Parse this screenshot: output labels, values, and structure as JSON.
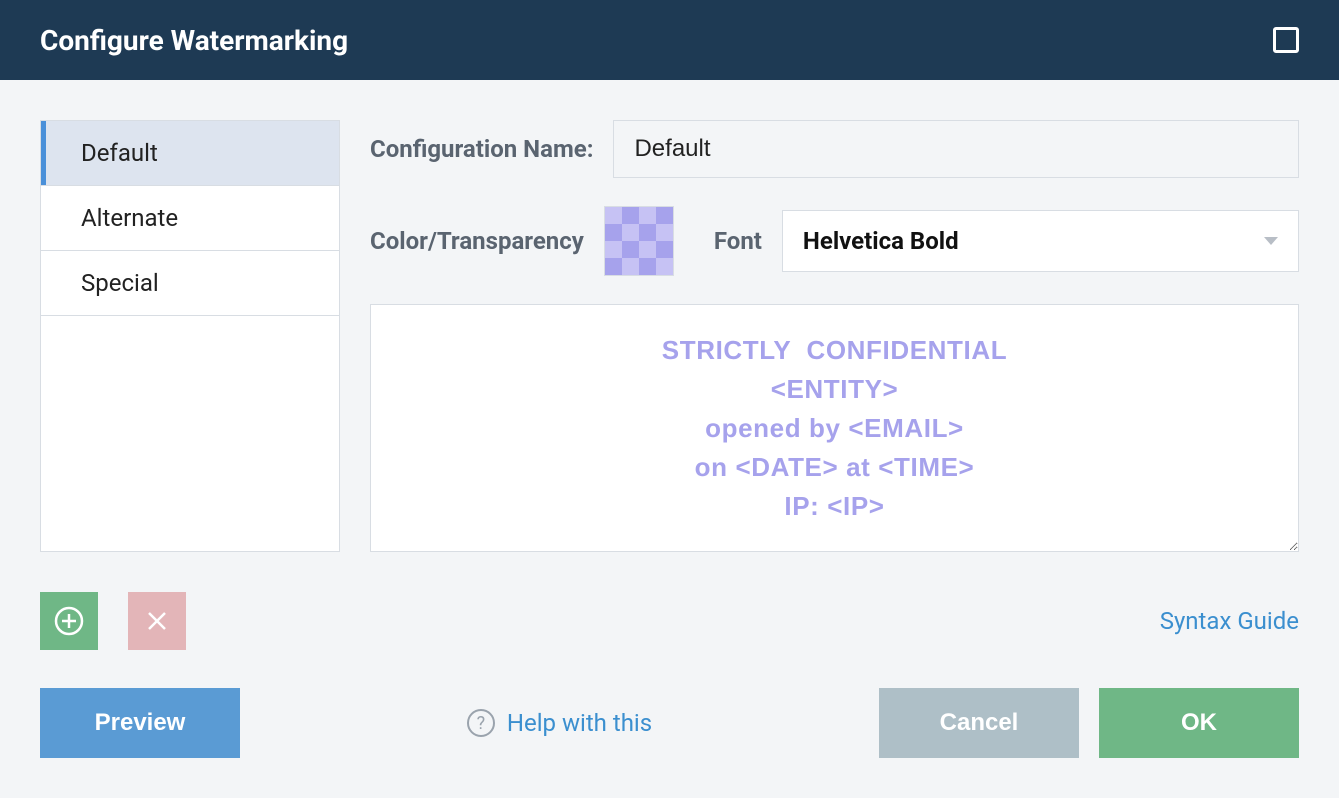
{
  "title": "Configure Watermarking",
  "sidebar": {
    "items": [
      {
        "label": "Default",
        "selected": true
      },
      {
        "label": "Alternate",
        "selected": false
      },
      {
        "label": "Special",
        "selected": false
      }
    ]
  },
  "form": {
    "config_name_label": "Configuration Name:",
    "config_name_value": "Default",
    "color_label": "Color/Transparency",
    "color_value": "#a6a2ec",
    "font_label": "Font",
    "font_value": "Helvetica Bold",
    "watermark_text": "STRICTLY  CONFIDENTIAL\n<ENTITY>\nopened by <EMAIL>\non <DATE> at <TIME>\nIP: <IP>"
  },
  "links": {
    "syntax_guide": "Syntax Guide",
    "help": "Help with this"
  },
  "buttons": {
    "preview": "Preview",
    "cancel": "Cancel",
    "ok": "OK"
  }
}
